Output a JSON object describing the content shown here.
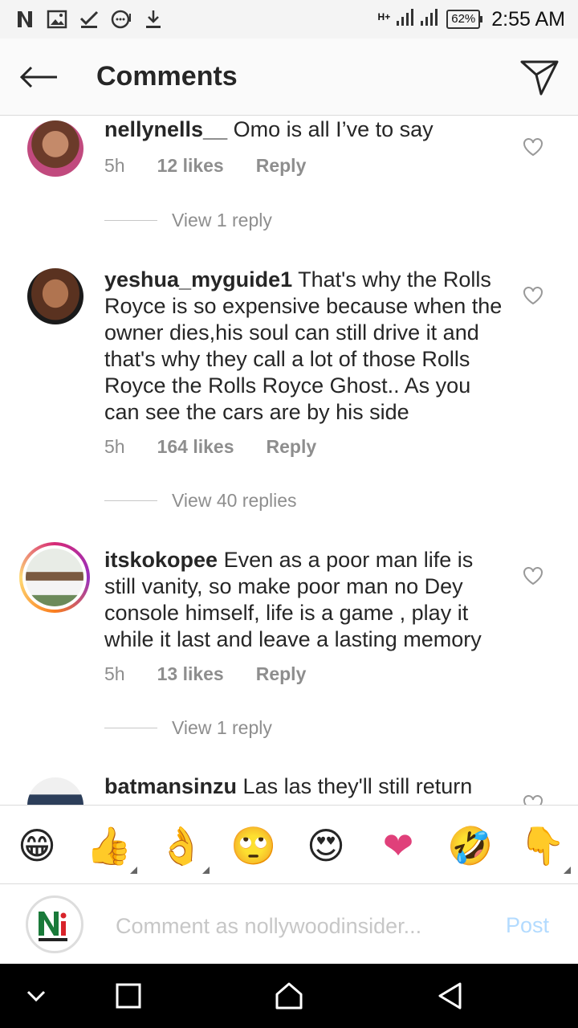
{
  "status_bar": {
    "network_label": "H+",
    "battery": "62%",
    "time": "2:55 AM"
  },
  "header": {
    "title": "Comments"
  },
  "comments": [
    {
      "username": "nellynells__",
      "text": "Omo is all I’ve to say",
      "time": "5h",
      "likes": "12 likes",
      "reply": "Reply",
      "view_replies": "View 1 reply"
    },
    {
      "username": "yeshua_myguide1",
      "text": "That's why the Rolls Royce is so expensive because when the owner dies,his soul can still drive it and that's why they call a lot of those Rolls Royce the Rolls Royce Ghost.. As you can see the cars are by his side",
      "time": "5h",
      "likes": "164 likes",
      "reply": "Reply",
      "view_replies": "View 40 replies"
    },
    {
      "username": "itskokopee",
      "text": "Even as a poor man life is still vanity, so make poor man no Dey console himself, life is a game , play it while it last and leave a lasting memory",
      "time": "5h",
      "likes": "13 likes",
      "reply": "Reply",
      "view_replies": "View 1 reply"
    },
    {
      "username": "batmansinzu",
      "text": "Las las they'll still return"
    }
  ],
  "emoji_bar": [
    "😁",
    "👍",
    "👌",
    "🙄",
    "😍",
    "❤",
    "🤣",
    "👇"
  ],
  "compose": {
    "placeholder": "Comment as nollywoodinsider...",
    "post_label": "Post"
  },
  "colors": {
    "primary_text": "#262626",
    "secondary_text": "#8e8e8e",
    "post_disabled": "#b3dbff"
  }
}
